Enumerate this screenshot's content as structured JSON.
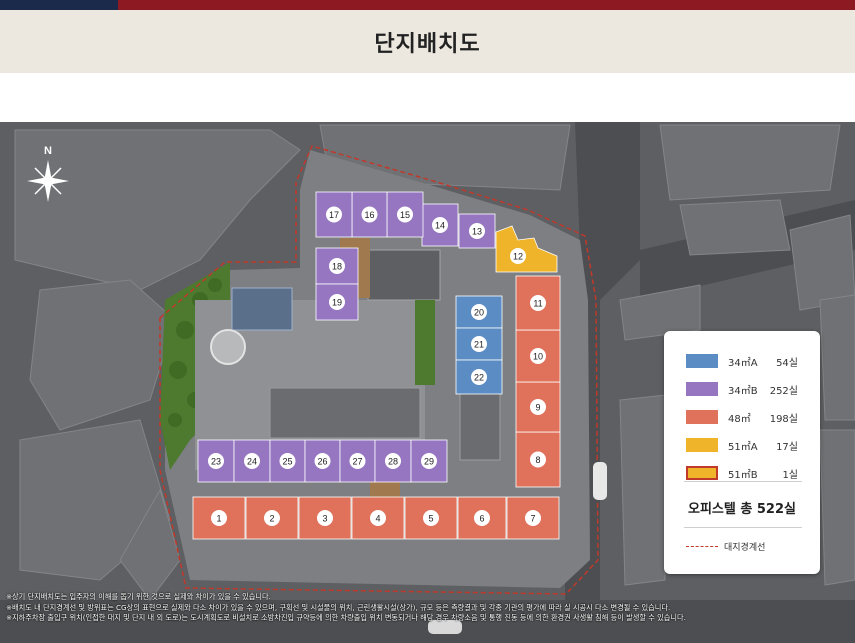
{
  "page_title": "단지배치도",
  "compass": {
    "label": "N"
  },
  "colors": {
    "type_34A": "#5b8cc4",
    "type_34B": "#9676c0",
    "type_48": "#e0725c",
    "type_51A": "#efb42a",
    "type_51B": "#efb42a",
    "site_boundary": "#c0392b"
  },
  "buildings": [
    {
      "no": "1",
      "type": "48"
    },
    {
      "no": "2",
      "type": "48"
    },
    {
      "no": "3",
      "type": "48"
    },
    {
      "no": "4",
      "type": "48"
    },
    {
      "no": "5",
      "type": "48"
    },
    {
      "no": "6",
      "type": "48"
    },
    {
      "no": "7",
      "type": "48"
    },
    {
      "no": "8",
      "type": "48"
    },
    {
      "no": "9",
      "type": "48"
    },
    {
      "no": "10",
      "type": "48"
    },
    {
      "no": "11",
      "type": "48"
    },
    {
      "no": "12",
      "type": "51A"
    },
    {
      "no": "13",
      "type": "34B"
    },
    {
      "no": "14",
      "type": "34B"
    },
    {
      "no": "15",
      "type": "34B"
    },
    {
      "no": "16",
      "type": "34B"
    },
    {
      "no": "17",
      "type": "34B"
    },
    {
      "no": "18",
      "type": "34B"
    },
    {
      "no": "19",
      "type": "34B"
    },
    {
      "no": "20",
      "type": "34A"
    },
    {
      "no": "21",
      "type": "34A"
    },
    {
      "no": "22",
      "type": "34A"
    },
    {
      "no": "23",
      "type": "34B"
    },
    {
      "no": "24",
      "type": "34B"
    },
    {
      "no": "25",
      "type": "34B"
    },
    {
      "no": "26",
      "type": "34B"
    },
    {
      "no": "27",
      "type": "34B"
    },
    {
      "no": "28",
      "type": "34B"
    },
    {
      "no": "29",
      "type": "34B"
    }
  ],
  "legend": {
    "items": [
      {
        "name": "34㎡A",
        "count": "54실",
        "color": "#5b8cc4",
        "outline": false
      },
      {
        "name": "34㎡B",
        "count": "252실",
        "color": "#9676c0",
        "outline": false
      },
      {
        "name": "48㎡",
        "count": "198실",
        "color": "#e0725c",
        "outline": false
      },
      {
        "name": "51㎡A",
        "count": "17실",
        "color": "#efb42a",
        "outline": false
      },
      {
        "name": "51㎡B",
        "count": "1실",
        "color": "#efb42a",
        "outline": true
      }
    ],
    "total": "오피스텔 총 522실",
    "boundary_label": "대지경계선"
  },
  "notes": [
    "※상기 단지배치도는 입주자의 이해를 돕기 위한 것으로 실제와 차이가 있을 수 있습니다.",
    "※배치도 내 단지경계선 및 방위표는 CG상의 표현으로 실제와 다소 차이가 있을 수 있으며, 구획선 및 시설물의 위치, 근린생활시설(상가), 규모 등은 측량결과 및 각종 기관의 평가에 따라 실 시공시 다소 변경될 수 있습니다.",
    "※지하주차장 출입구 위치(인접한 대지 및 단지 내 외 도로)는 도시계획도로 비설치로 소방차진입 규약등에 의한 차량출입 위치 변동되거나 해당 경우 차량소음 및 통행 진동 등에 의한 환경권 사생활 침해 등이 발생할 수 있습니다."
  ]
}
